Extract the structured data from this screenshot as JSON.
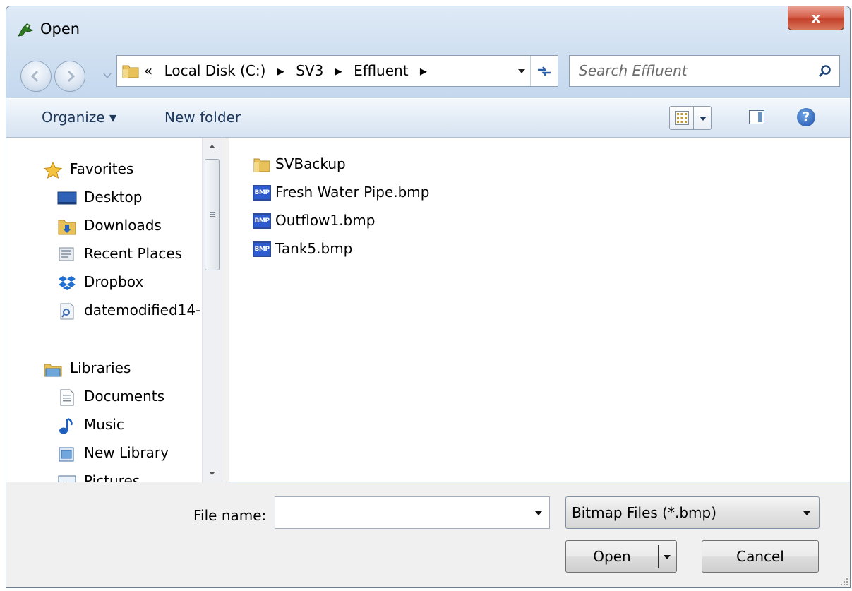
{
  "window": {
    "title": "Open",
    "close_label": "x"
  },
  "address": {
    "breadcrumbs": [
      "«",
      "Local Disk (C:)",
      "▸",
      "SV3",
      "▸",
      "Effluent",
      "▸"
    ]
  },
  "search": {
    "placeholder": "Search Effluent"
  },
  "toolbar": {
    "organize_label": "Organize ▾",
    "new_folder_label": "New folder",
    "help_label": "?"
  },
  "nav": {
    "favorites": {
      "label": "Favorites",
      "items": [
        "Desktop",
        "Downloads",
        "Recent Places",
        "Dropbox",
        "datemodified14-"
      ]
    },
    "libraries": {
      "label": "Libraries",
      "items": [
        "Documents",
        "Music",
        "New Library",
        "Pictures"
      ]
    }
  },
  "files": [
    {
      "name": "SVBackup",
      "type": "folder"
    },
    {
      "name": "Fresh Water Pipe.bmp",
      "type": "bmp"
    },
    {
      "name": "Outflow1.bmp",
      "type": "bmp"
    },
    {
      "name": "Tank5.bmp",
      "type": "bmp"
    }
  ],
  "bmp_icon_text": "BMP",
  "footer": {
    "file_name_label": "File name:",
    "file_name_value": "",
    "file_type_value": "Bitmap Files (*.bmp)",
    "open_label": "Open",
    "cancel_label": "Cancel"
  },
  "colors": {
    "accent": "#1e395b",
    "close_button": "#c3402a",
    "folder": "#e8c15a",
    "bmp_icon": "#2f5bd0"
  }
}
